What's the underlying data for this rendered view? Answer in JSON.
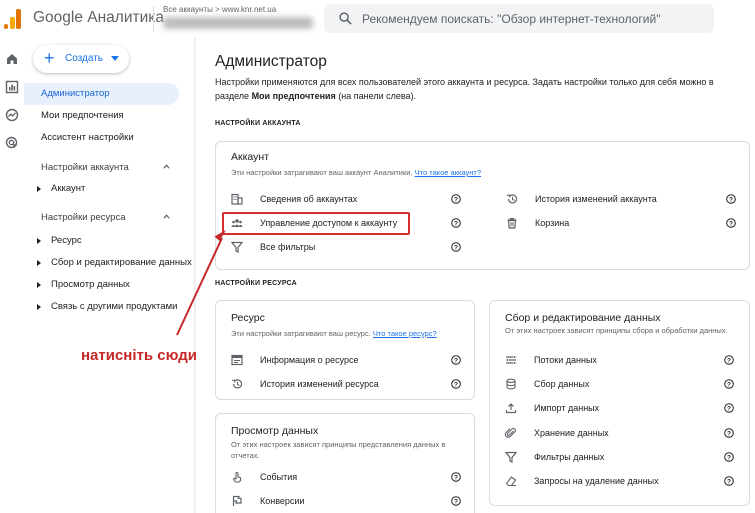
{
  "header": {
    "app_title": "Google Аналитика",
    "accounts_line": "Все аккаунты > www.knr.net.ua",
    "search_placeholder": "Рекомендуем поискать: \"Обзор интернет-технологий\""
  },
  "sidebar": {
    "create_label": "Создать",
    "top_items": [
      "Администратор",
      "Мои предпочтения",
      "Ассистент настройки"
    ],
    "account_section": "Настройки аккаунта",
    "account_items": [
      "Аккаунт"
    ],
    "property_section": "Настройки ресурса",
    "property_items": [
      "Ресурс",
      "Сбор и редактирование данных",
      "Просмотр данных",
      "Связь с другими продуктами"
    ]
  },
  "main": {
    "title": "Администратор",
    "intro_text": "Настройки применяются для всех пользователей этого аккаунта и ресурса. Задать настройки только для себя можно в разделе ",
    "intro_bold": "Мои предпочтения",
    "intro_tail": " (на панели слева).",
    "account_settings_label": "НАСТРОЙКИ АККАУНТА",
    "property_settings_label": "НАСТРОЙКИ РЕСУРСА",
    "account_card": {
      "title": "Аккаунт",
      "subtitle": "Эти настройки затрагивают ваш аккаунт Аналитики.",
      "link": "Что такое аккаунт?",
      "left_items": [
        "Сведения об аккаунтах",
        "Управление доступом к аккаунту",
        "Все фильтры"
      ],
      "right_items": [
        "История изменений аккаунта",
        "Корзина"
      ]
    },
    "resource_card": {
      "title": "Ресурс",
      "subtitle": "Эти настройки затрагивают ваш ресурс.",
      "link": "Что такое ресурс?",
      "items": [
        "Информация о ресурсе",
        "История изменений ресурса"
      ]
    },
    "view_card": {
      "title": "Просмотр данных",
      "subtitle": "От этих настроек зависят принципы представления данных в отчетах.",
      "items": [
        "События",
        "Конверсии"
      ]
    },
    "collect_card": {
      "title": "Сбор и редактирование данных",
      "subtitle": "От этих настроек зависят принципы сбора и обработки данных.",
      "items": [
        "Потоки данных",
        "Сбор данных",
        "Импорт данных",
        "Хранение данных",
        "Фильтры данных",
        "Запросы на удаление данных"
      ]
    }
  },
  "annotation": {
    "text": "натисніть сюди",
    "color": "#c62828"
  },
  "colors": {
    "accent": "#1a73e8",
    "highlight": "#d32f2f"
  }
}
